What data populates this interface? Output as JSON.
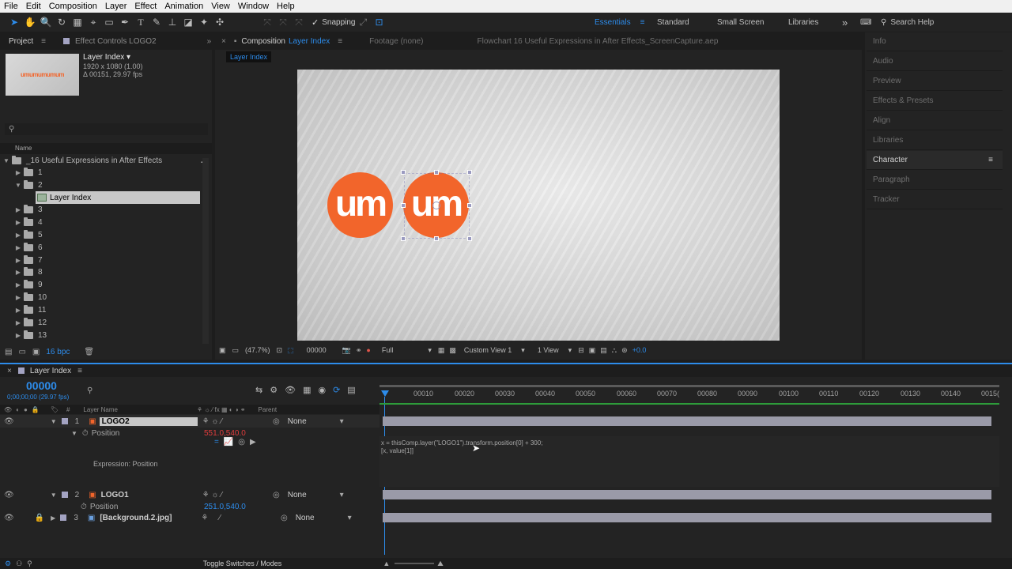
{
  "menu": [
    "File",
    "Edit",
    "Composition",
    "Layer",
    "Effect",
    "Animation",
    "View",
    "Window",
    "Help"
  ],
  "toolbar": {
    "snapping_label": "Snapping",
    "workspaces": [
      "Essentials",
      "Standard",
      "Small Screen",
      "Libraries"
    ],
    "search_label": "Search Help"
  },
  "project": {
    "tab_project": "Project",
    "tab_effect_controls": "Effect Controls LOGO2",
    "thumb_text": "umumumumum",
    "selected_name": "Layer Index",
    "selected_dims": "1920 x 1080 (1.00)",
    "selected_dur": "Δ 00151, 29.97 fps",
    "search_placeholder": "",
    "col_name": "Name",
    "root_folder": "_16 Useful Expressions in After Effects",
    "items": [
      "1",
      "2",
      "Layer Index",
      "3",
      "4",
      "5",
      "6",
      "7",
      "8",
      "9",
      "10",
      "11",
      "12",
      "13"
    ],
    "bpc": "16 bpc"
  },
  "comp": {
    "close": "×",
    "tab_prefix": "Composition",
    "tab_name": "Layer Index",
    "tab_footage": "Footage (none)",
    "file_name": "Flowchart 16 Useful Expressions in After Effects_ScreenCapture.aep",
    "breadcrumb": "Layer Index",
    "logo_text": "um",
    "zoom": "(47.7%)",
    "timecode": "00000",
    "resolution": "Full",
    "view": "Custom View 1",
    "views": "1 View",
    "exposure": "+0.0"
  },
  "right_panels": [
    "Info",
    "Audio",
    "Preview",
    "Effects & Presets",
    "Align",
    "Libraries",
    "Character",
    "Paragraph",
    "Tracker"
  ],
  "timeline": {
    "tab": "Layer Index",
    "timecode": "00000",
    "frame_info": "0;00;00;00 (29.97 fps)",
    "col_layer_name": "Layer Name",
    "col_parent": "Parent",
    "ruler": [
      "00010",
      "00020",
      "00030",
      "00040",
      "00050",
      "00060",
      "00070",
      "00080",
      "00090",
      "00100",
      "00110",
      "00120",
      "00130",
      "00140",
      "0015("
    ],
    "layers": [
      {
        "num": "1",
        "name": "LOGO2",
        "prop": "Position",
        "value": "551.0,540.0",
        "parent": "None"
      },
      {
        "num": "2",
        "name": "LOGO1",
        "prop": "Position",
        "value": "251.0,540.0",
        "parent": "None"
      },
      {
        "num": "3",
        "name": "[Background.2.jpg]",
        "parent": "None"
      }
    ],
    "expression_label": "Expression: Position",
    "expression_line1": "x = thisComp.layer(\"LOGO1\").transform.position[0] + 300;",
    "expression_line2": "[x, value[1]]",
    "toggle_label": "Toggle Switches / Modes"
  },
  "colors": {
    "accent": "#2d8ceb",
    "logo": "#f2652b",
    "label_swatch": "#a3a3c2"
  }
}
